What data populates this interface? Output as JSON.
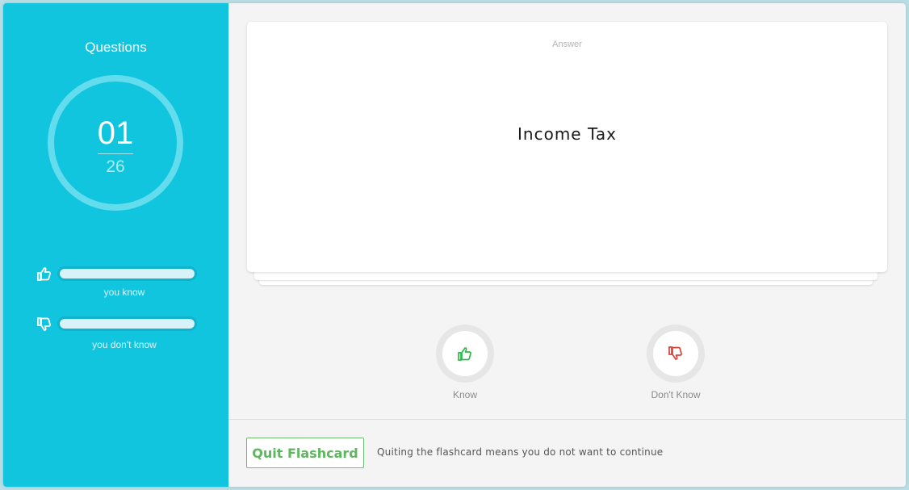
{
  "sidebar": {
    "title": "Questions",
    "progress": {
      "current": "01",
      "total": "26"
    },
    "know": {
      "label": "you know",
      "fraction": 0
    },
    "dont_know": {
      "label": "you don't know",
      "fraction": 0
    }
  },
  "card": {
    "label": "Answer",
    "text": "Income Tax"
  },
  "actions": {
    "know_label": "Know",
    "dont_know_label": "Don't Know"
  },
  "footer": {
    "quit_label": "Quit Flashcard",
    "note": "Quiting the flashcard means you do not want to continue"
  },
  "colors": {
    "sidebar": "#12c5df",
    "know": "#2fb84a",
    "dont_know": "#d9433a",
    "quit": "#5cb85c"
  }
}
